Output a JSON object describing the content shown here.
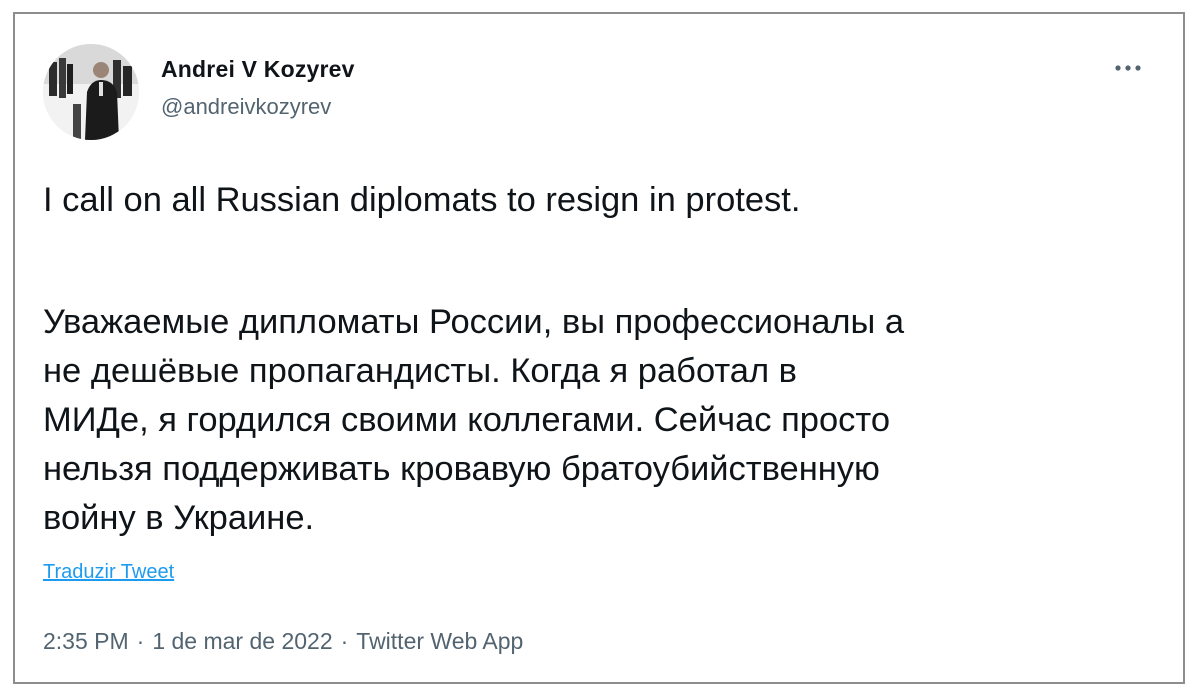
{
  "tweet": {
    "author": {
      "name": "Andrei V Kozyrev",
      "handle": "@andreivkozyrev"
    },
    "text_lines": [
      "I call on all Russian diplomats to resign in protest.",
      "Уважаемые дипломаты России, вы профессионалы а",
      "не дешёвые пропагандисты. Когда я работал в",
      "МИДе, я гордился своими коллегами. Сейчас просто",
      "нельзя поддерживать кровавую братоубийственную",
      "войну в Украине."
    ],
    "translate_label": "Traduzir Tweet",
    "meta": {
      "time": "2:35 PM",
      "date": "1 de mar de 2022",
      "source": "Twitter Web App",
      "separator": "·"
    }
  },
  "icons": {
    "avatar": "avatar-photo",
    "more": "more-options-icon"
  },
  "colors": {
    "text": "#0f1419",
    "secondary": "#536471",
    "link": "#1d9bf0",
    "border": "#8d8d8d"
  }
}
